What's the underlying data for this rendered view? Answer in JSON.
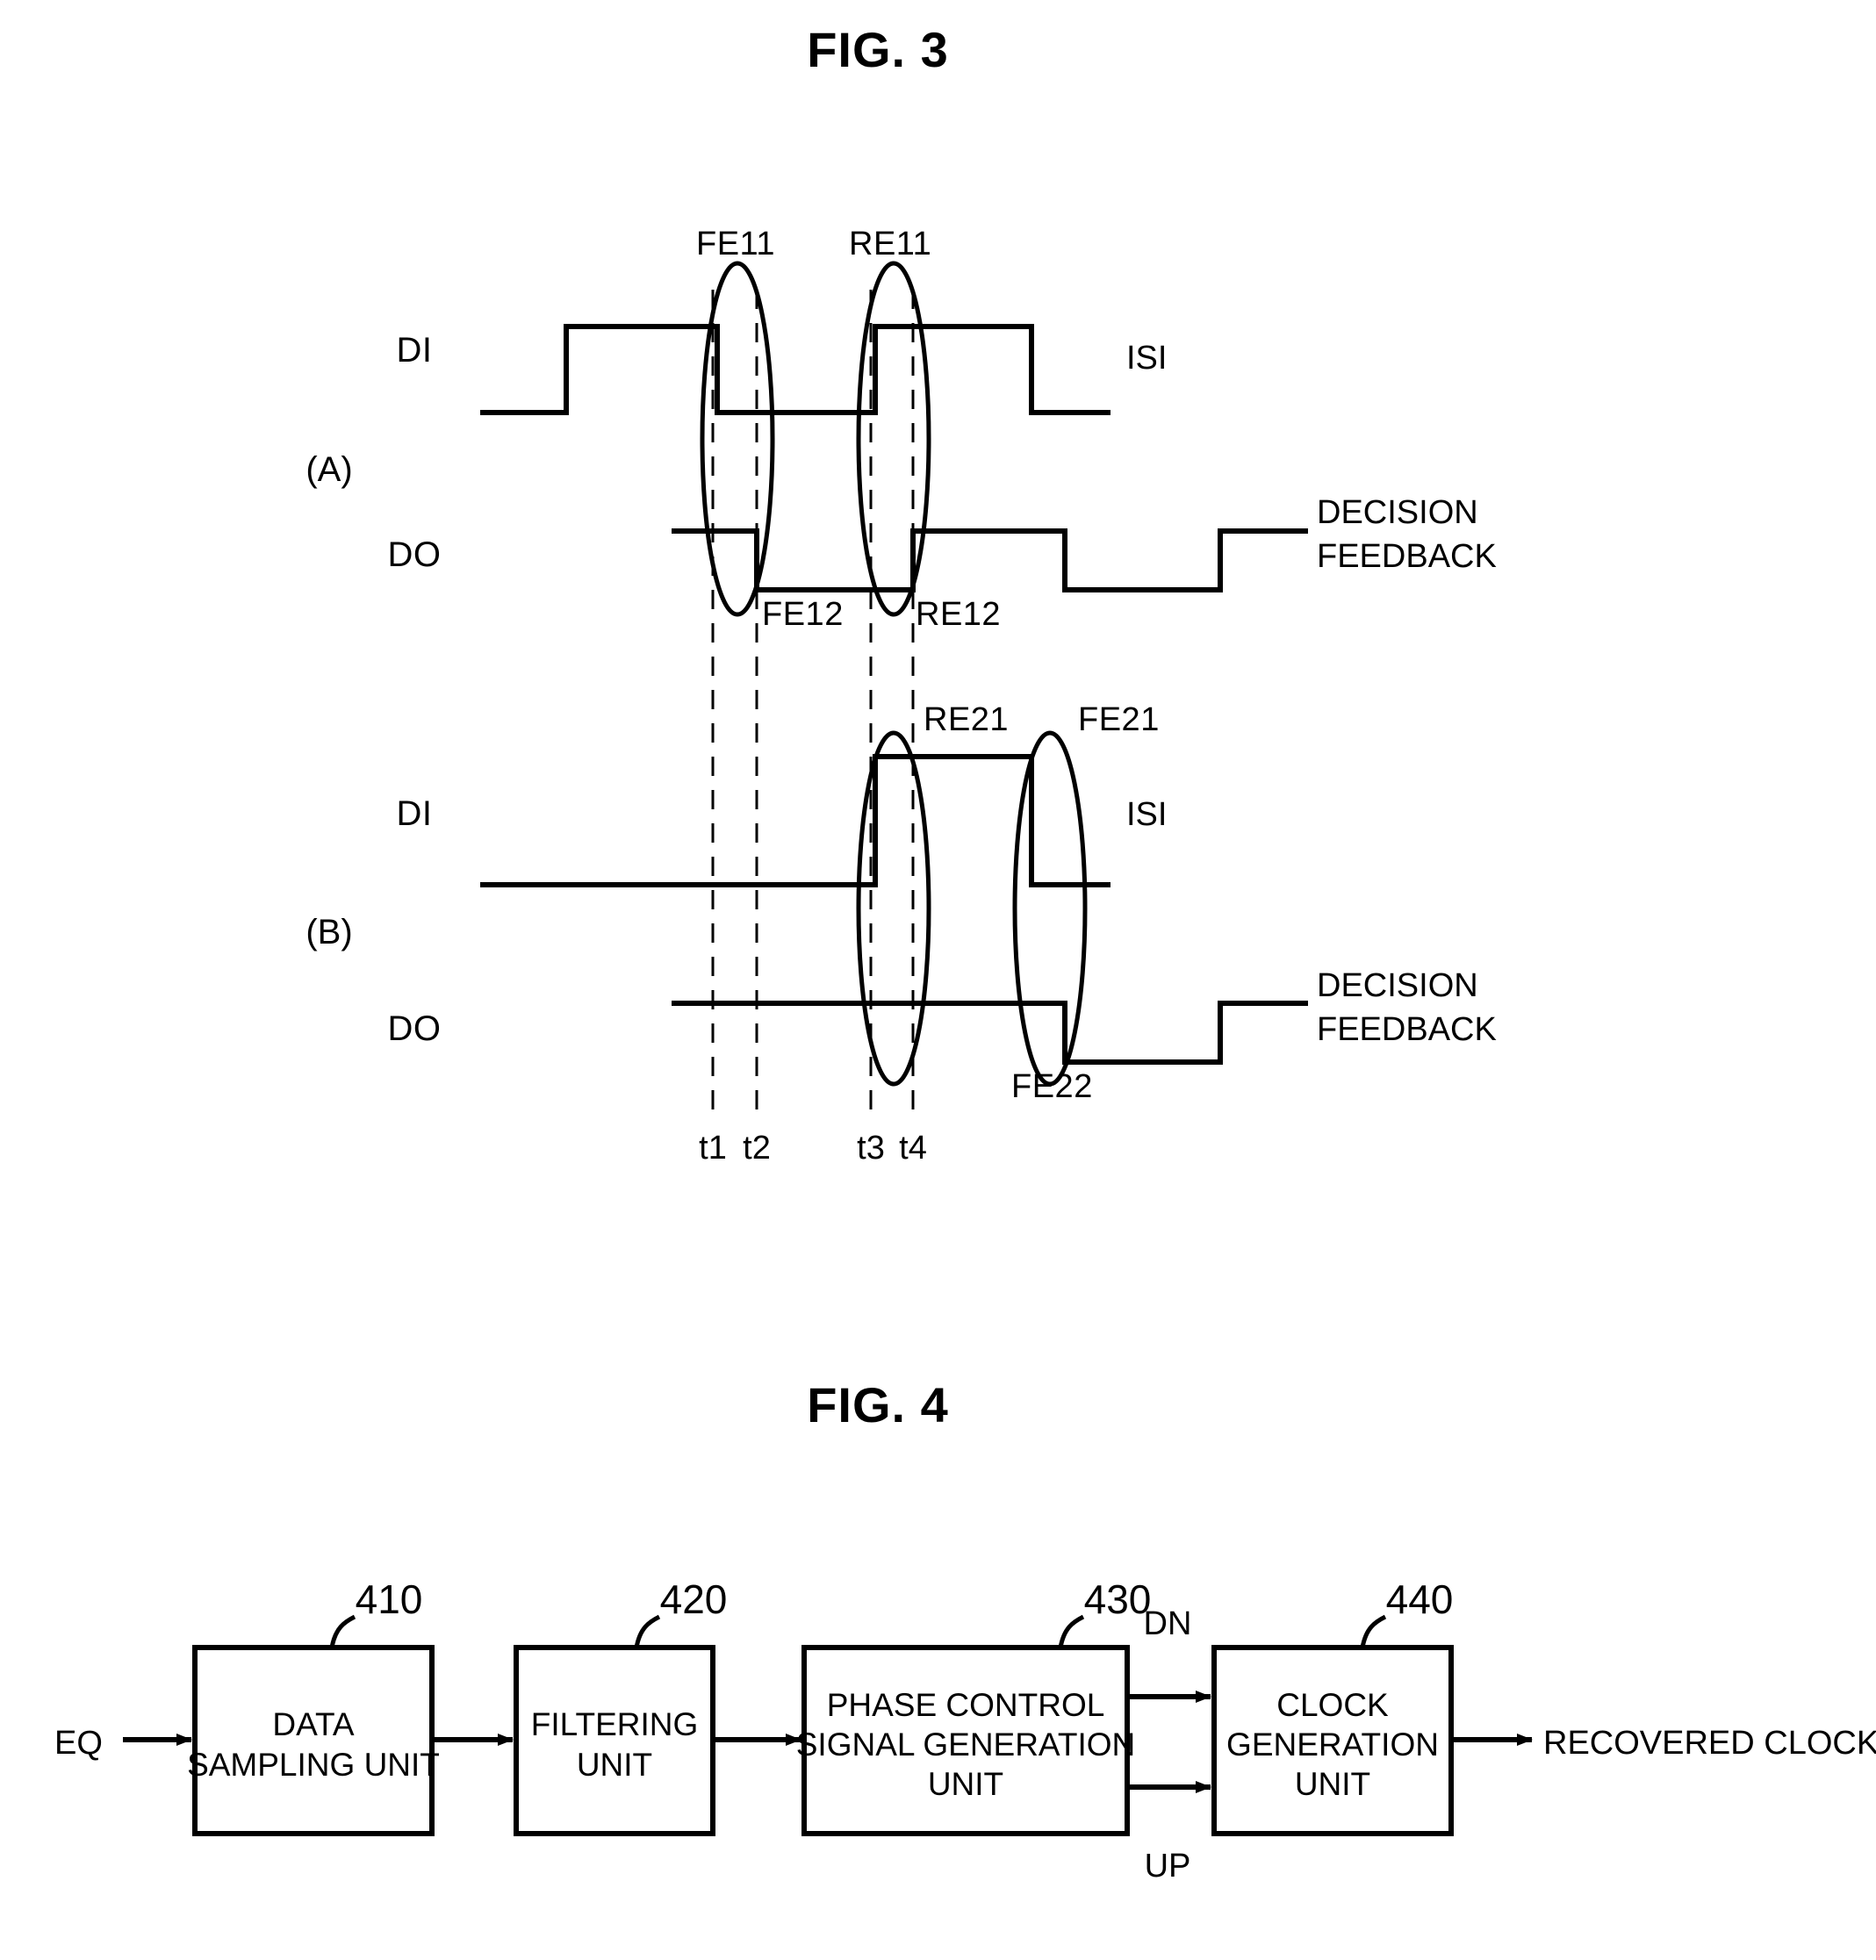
{
  "figures": [
    {
      "title": "FIG. 3",
      "sections": [
        {
          "label": "(A)"
        },
        {
          "label": "(B)"
        }
      ],
      "signals": {
        "di": "DI",
        "do": "DO"
      },
      "notes": {
        "isi": "ISI",
        "decision": "DECISION",
        "feedback": "FEEDBACK"
      },
      "edge_labels_a": {
        "fe11": "FE11",
        "re11": "RE11",
        "fe12": "FE12",
        "re12": "RE12"
      },
      "edge_labels_b": {
        "re21": "RE21",
        "fe21": "FE21",
        "fe22": "FE22"
      },
      "time_marks": [
        "t1",
        "t2",
        "t3",
        "t4"
      ]
    },
    {
      "title": "FIG. 4",
      "input_label": "EQ",
      "output_label": "RECOVERED CLOCK",
      "blocks": [
        {
          "ref": "410",
          "line1": "DATA",
          "line2": "SAMPLING UNIT",
          "line3": ""
        },
        {
          "ref": "420",
          "line1": "FILTERING",
          "line2": "UNIT",
          "line3": ""
        },
        {
          "ref": "430",
          "line1": "PHASE CONTROL",
          "line2": "SIGNAL GENERATION",
          "line3": "UNIT"
        },
        {
          "ref": "440",
          "line1": "CLOCK",
          "line2": "GENERATION",
          "line3": "UNIT"
        }
      ],
      "ports": {
        "dn": "DN",
        "up": "UP"
      }
    }
  ],
  "colors": {
    "ink": "#000000",
    "paper": "#ffffff"
  }
}
